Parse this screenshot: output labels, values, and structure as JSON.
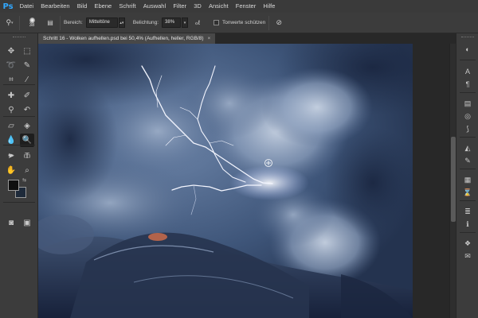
{
  "app": {
    "logo": "Ps"
  },
  "menubar": {
    "items": [
      "Datei",
      "Bearbeiten",
      "Bild",
      "Ebene",
      "Schrift",
      "Auswahl",
      "Filter",
      "3D",
      "Ansicht",
      "Fenster",
      "Hilfe"
    ]
  },
  "options": {
    "brush_size": "38",
    "range_label": "Bereich:",
    "range_value": "Mitteltöne",
    "exposure_label": "Belichtung:",
    "exposure_value": "38%",
    "protect_tones_label": "Tonwerte schützen",
    "protect_tones_checked": false
  },
  "document": {
    "tab_title": "Schritt 16 - Wolken aufhellen.psd bei 50,4% (Aufhellen, heller, RGB/8)",
    "tab_close": "×"
  },
  "colors": {
    "foreground": "#0f0f0f",
    "background": "#1e2a3a",
    "ui_dark": "#282828",
    "ui_panel": "#3c3c3c",
    "accent": "#31a8ff"
  },
  "tools": [
    {
      "name": "move-tool-icon",
      "glyph": "✥"
    },
    {
      "name": "marquee-tool-icon",
      "glyph": "⬚"
    },
    {
      "name": "lasso-tool-icon",
      "glyph": "➰"
    },
    {
      "name": "quick-selection-tool-icon",
      "glyph": "✎"
    },
    {
      "name": "crop-tool-icon",
      "glyph": "⌗"
    },
    {
      "name": "eyedropper-tool-icon",
      "glyph": "⁄"
    },
    {
      "name": "healing-brush-tool-icon",
      "glyph": "✚"
    },
    {
      "name": "brush-tool-icon",
      "glyph": "✐"
    },
    {
      "name": "clone-stamp-tool-icon",
      "glyph": "⚲"
    },
    {
      "name": "history-brush-tool-icon",
      "glyph": "↶"
    },
    {
      "name": "eraser-tool-icon",
      "glyph": "▱"
    },
    {
      "name": "paint-bucket-tool-icon",
      "glyph": "◈"
    },
    {
      "name": "blur-tool-icon",
      "glyph": "💧"
    },
    {
      "name": "dodge-tool-icon",
      "glyph": "🔍"
    },
    {
      "name": "pen-tool-icon",
      "glyph": "✒"
    },
    {
      "name": "type-tool-icon",
      "glyph": "T"
    },
    {
      "name": "path-selection-tool-icon",
      "glyph": "➤"
    },
    {
      "name": "rectangle-tool-icon",
      "glyph": "▭"
    },
    {
      "name": "hand-tool-icon",
      "glyph": "✋"
    },
    {
      "name": "zoom-tool-icon",
      "glyph": "⌕"
    },
    {
      "name": "quick-mask-icon",
      "glyph": "◙"
    },
    {
      "name": "screen-mode-icon",
      "glyph": "▣"
    }
  ],
  "dock": [
    {
      "name": "color-panel-icon",
      "glyph": "◐"
    },
    {
      "name": "character-panel-icon",
      "glyph": "A"
    },
    {
      "name": "paragraph-panel-icon",
      "glyph": "¶"
    },
    {
      "name": "layers-panel-icon",
      "glyph": "▤"
    },
    {
      "name": "channels-panel-icon",
      "glyph": "◎"
    },
    {
      "name": "paths-panel-icon",
      "glyph": "⟆"
    },
    {
      "name": "adjustments-panel-icon",
      "glyph": "◭"
    },
    {
      "name": "brush-presets-panel-icon",
      "glyph": "✎"
    },
    {
      "name": "swatches-panel-icon",
      "glyph": "▦"
    },
    {
      "name": "history-panel-icon",
      "glyph": "⌛"
    },
    {
      "name": "properties-panel-icon",
      "glyph": "≣"
    },
    {
      "name": "info-panel-icon",
      "glyph": "ℹ"
    },
    {
      "name": "styles-panel-icon",
      "glyph": "❖"
    },
    {
      "name": "notes-panel-icon",
      "glyph": "✉"
    }
  ]
}
